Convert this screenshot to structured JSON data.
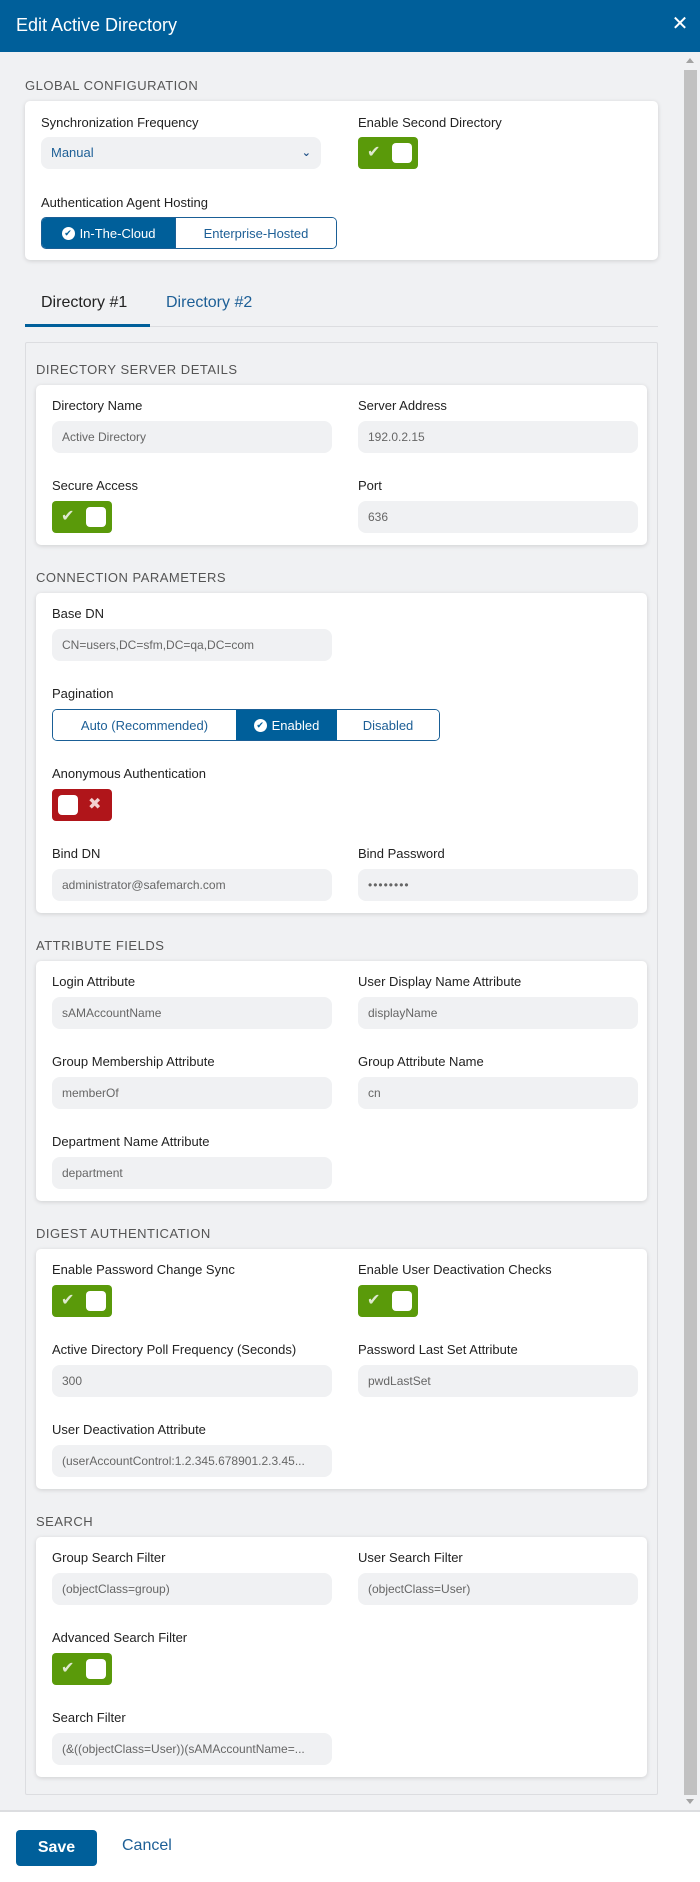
{
  "header": {
    "title": "Edit Active Directory",
    "close_icon": "close-icon"
  },
  "global": {
    "section_title": "GLOBAL CONFIGURATION",
    "sync_label": "Synchronization Frequency",
    "sync_value": "Manual",
    "second_dir_label": "Enable Second Directory",
    "second_dir_enabled": true,
    "hosting_label": "Authentication Agent Hosting",
    "hosting_options": [
      "In-The-Cloud",
      "Enterprise-Hosted"
    ],
    "hosting_selected": "In-The-Cloud"
  },
  "tabs": [
    {
      "label": "Directory #1",
      "active": true
    },
    {
      "label": "Directory #2",
      "active": false
    }
  ],
  "server": {
    "section_title": "DIRECTORY SERVER DETAILS",
    "name_label": "Directory Name",
    "name_value": "Active Directory",
    "address_label": "Server Address",
    "address_value": "192.0.2.15",
    "secure_label": "Secure Access",
    "secure_enabled": true,
    "port_label": "Port",
    "port_value": "636"
  },
  "connection": {
    "section_title": "CONNECTION PARAMETERS",
    "base_dn_label": "Base DN",
    "base_dn_value": "CN=users,DC=sfm,DC=qa,DC=com",
    "pagination_label": "Pagination",
    "pagination_options": [
      "Auto (Recommended)",
      "Enabled",
      "Disabled"
    ],
    "pagination_selected": "Enabled",
    "anon_label": "Anonymous Authentication",
    "anon_enabled": false,
    "bind_dn_label": "Bind DN",
    "bind_dn_value": "administrator@safemarch.com",
    "bind_password_label": "Bind Password",
    "bind_password_value": "••••••••"
  },
  "attributes": {
    "section_title": "ATTRIBUTE FIELDS",
    "login_label": "Login Attribute",
    "login_value": "sAMAccountName",
    "display_label": "User Display Name Attribute",
    "display_value": "displayName",
    "group_member_label": "Group Membership Attribute",
    "group_member_value": "memberOf",
    "group_attr_label": "Group Attribute Name",
    "group_attr_value": "cn",
    "dept_label": "Department Name Attribute",
    "dept_value": "department"
  },
  "digest": {
    "section_title": "DIGEST AUTHENTICATION",
    "pwd_sync_label": "Enable Password Change Sync",
    "pwd_sync_enabled": true,
    "deact_checks_label": "Enable User Deactivation Checks",
    "deact_checks_enabled": true,
    "poll_label": "Active Directory Poll Frequency (Seconds)",
    "poll_value": "300",
    "pwd_last_set_label": "Password Last Set Attribute",
    "pwd_last_set_value": "pwdLastSet",
    "deact_attr_label": "User Deactivation Attribute",
    "deact_attr_value": "(userAccountControl:1.2.345.678901.2.3.45..."
  },
  "search": {
    "section_title": "SEARCH",
    "group_filter_label": "Group Search Filter",
    "group_filter_value": "(objectClass=group)",
    "user_filter_label": "User Search Filter",
    "user_filter_value": "(objectClass=User)",
    "advanced_label": "Advanced Search Filter",
    "advanced_enabled": true,
    "filter_label": "Search Filter",
    "filter_value": "(&((objectClass=User))(sAMAccountName=..."
  },
  "footer": {
    "save_label": "Save",
    "cancel_label": "Cancel"
  },
  "icons": {
    "check": "✔",
    "cross": "✖",
    "chevron": "⌄",
    "close": "✕"
  },
  "colors": {
    "brand": "#005f9a",
    "toggle_on": "#5a9a0a",
    "toggle_off": "#b0151a"
  }
}
